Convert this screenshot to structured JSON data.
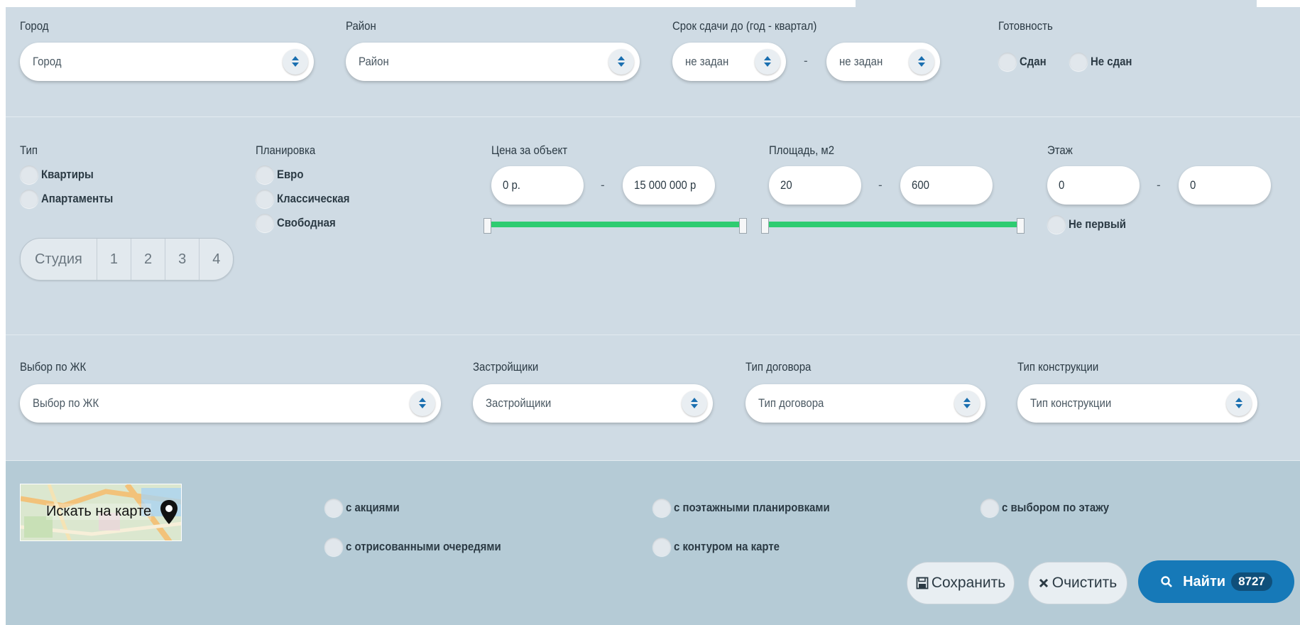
{
  "filters_top": {
    "city": {
      "label": "Город",
      "placeholder": "Город"
    },
    "district": {
      "label": "Район",
      "placeholder": "Район"
    },
    "deadline": {
      "label": "Срок сдачи до (год - квартал)",
      "from": "не задан",
      "sep": "-",
      "to": "не задан"
    },
    "readiness": {
      "label": "Готовность",
      "options": [
        "Сдан",
        "Не сдан"
      ]
    }
  },
  "filters_mid": {
    "type": {
      "label": "Тип",
      "options": [
        "Квартиры",
        "Апартаменты"
      ]
    },
    "layout": {
      "label": "Планировка",
      "options": [
        "Евро",
        "Классическая",
        "Свободная"
      ]
    },
    "price": {
      "label": "Цена за объект",
      "from": "0 р.",
      "sep": "-",
      "to": "15 000 000 р",
      "range": {
        "min": 0,
        "max": 15000000,
        "from_fraction": 0.0,
        "to_fraction": 1.0
      }
    },
    "area": {
      "label": "Площадь, м2",
      "from": "20",
      "sep": "-",
      "to": "600",
      "range": {
        "min": 20,
        "max": 600,
        "from_fraction": 0.0,
        "to_fraction": 1.0
      }
    },
    "floor": {
      "label": "Этаж",
      "from": "0",
      "sep": "-",
      "to": "0",
      "not_first": "Не первый"
    },
    "rooms": [
      "Студия",
      "1",
      "2",
      "3",
      "4"
    ]
  },
  "filters_bottom": {
    "complex": {
      "label": "Выбор по ЖК",
      "placeholder": "Выбор по ЖК"
    },
    "developers": {
      "label": "Застройщики",
      "placeholder": "Застройщики"
    },
    "contract": {
      "label": "Тип договора",
      "placeholder": "Тип договора"
    },
    "construction": {
      "label": "Тип конструкции",
      "placeholder": "Тип конструкции"
    }
  },
  "extras": {
    "map_link": "Искать на карте",
    "options": [
      "с акциями",
      "с поэтажными планировками",
      "с выбором по этажу",
      "с отрисованными очередями",
      "с контуром на карте"
    ]
  },
  "actions": {
    "save": "Сохранить",
    "clear": "Очистить",
    "find": "Найти",
    "count": "8727"
  },
  "colors": {
    "accent": "#1679b8",
    "slider": "#2ecc71",
    "panel": "#cfdbe4",
    "panel_dark": "#b5cbd6"
  },
  "icons": [
    "chevron-updown-icon",
    "close-icon",
    "map-pin-icon",
    "save-icon",
    "clear-x-icon",
    "search-icon"
  ]
}
